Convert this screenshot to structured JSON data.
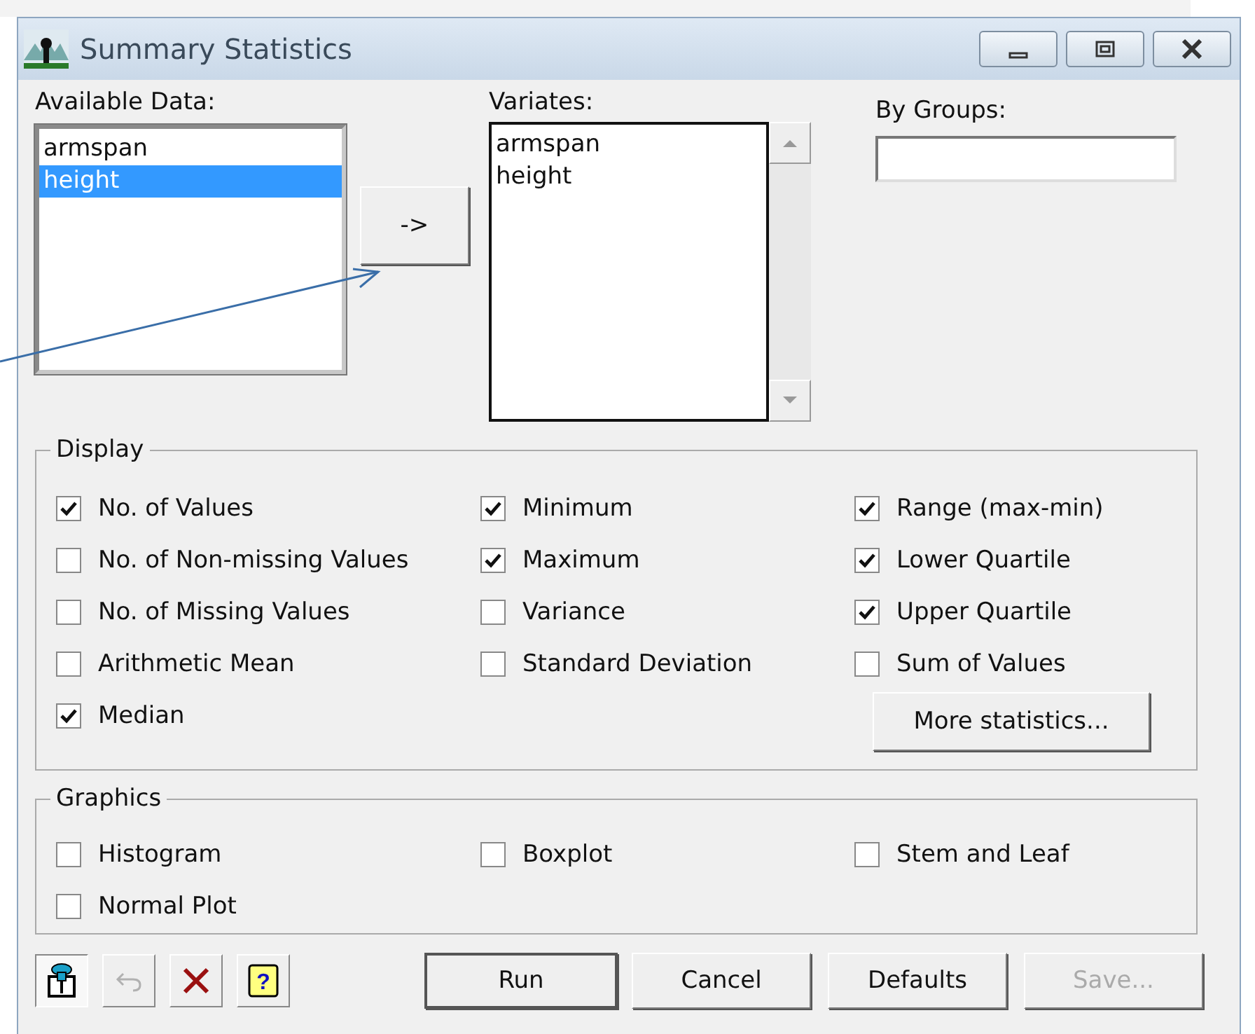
{
  "window": {
    "title": "Summary Statistics"
  },
  "available_data": {
    "label": "Available Data:",
    "items": [
      {
        "label": "armspan",
        "selected": false
      },
      {
        "label": "height",
        "selected": true
      }
    ]
  },
  "add_button": {
    "label": "->"
  },
  "variates": {
    "label": "Variates:",
    "items": [
      "armspan",
      "height"
    ]
  },
  "by_groups": {
    "label": "By Groups:"
  },
  "display": {
    "title": "Display",
    "columns": [
      [
        {
          "label": "No. of Values",
          "checked": true
        },
        {
          "label": "No. of Non-missing Values",
          "checked": false
        },
        {
          "label": "No. of Missing Values",
          "checked": false
        },
        {
          "label": "Arithmetic Mean",
          "checked": false
        },
        {
          "label": "Median",
          "checked": true
        }
      ],
      [
        {
          "label": "Minimum",
          "checked": true
        },
        {
          "label": "Maximum",
          "checked": true
        },
        {
          "label": "Variance",
          "checked": false
        },
        {
          "label": "Standard Deviation",
          "checked": false
        }
      ],
      [
        {
          "label": "Range (max-min)",
          "checked": true
        },
        {
          "label": "Lower Quartile",
          "checked": true
        },
        {
          "label": "Upper Quartile",
          "checked": true
        },
        {
          "label": "Sum of Values",
          "checked": false
        }
      ]
    ],
    "more_button": "More statistics..."
  },
  "graphics": {
    "title": "Graphics",
    "columns": [
      [
        {
          "label": "Histogram",
          "checked": false
        },
        {
          "label": "Normal Plot",
          "checked": false
        }
      ],
      [
        {
          "label": "Boxplot",
          "checked": false
        }
      ],
      [
        {
          "label": "Stem and Leaf",
          "checked": false
        }
      ]
    ]
  },
  "tools": [
    {
      "kind": "pin",
      "pressed": true,
      "disabled": false
    },
    {
      "kind": "undo",
      "pressed": false,
      "disabled": true
    },
    {
      "kind": "clear",
      "pressed": false,
      "disabled": false
    },
    {
      "kind": "help",
      "pressed": false,
      "disabled": false,
      "glyph": "?"
    }
  ],
  "buttons": [
    {
      "label": "Run",
      "default": true,
      "disabled": false
    },
    {
      "label": "Cancel",
      "default": false,
      "disabled": false
    },
    {
      "label": "Defaults",
      "default": false,
      "disabled": false
    },
    {
      "label": "Save...",
      "default": false,
      "disabled": true
    }
  ]
}
